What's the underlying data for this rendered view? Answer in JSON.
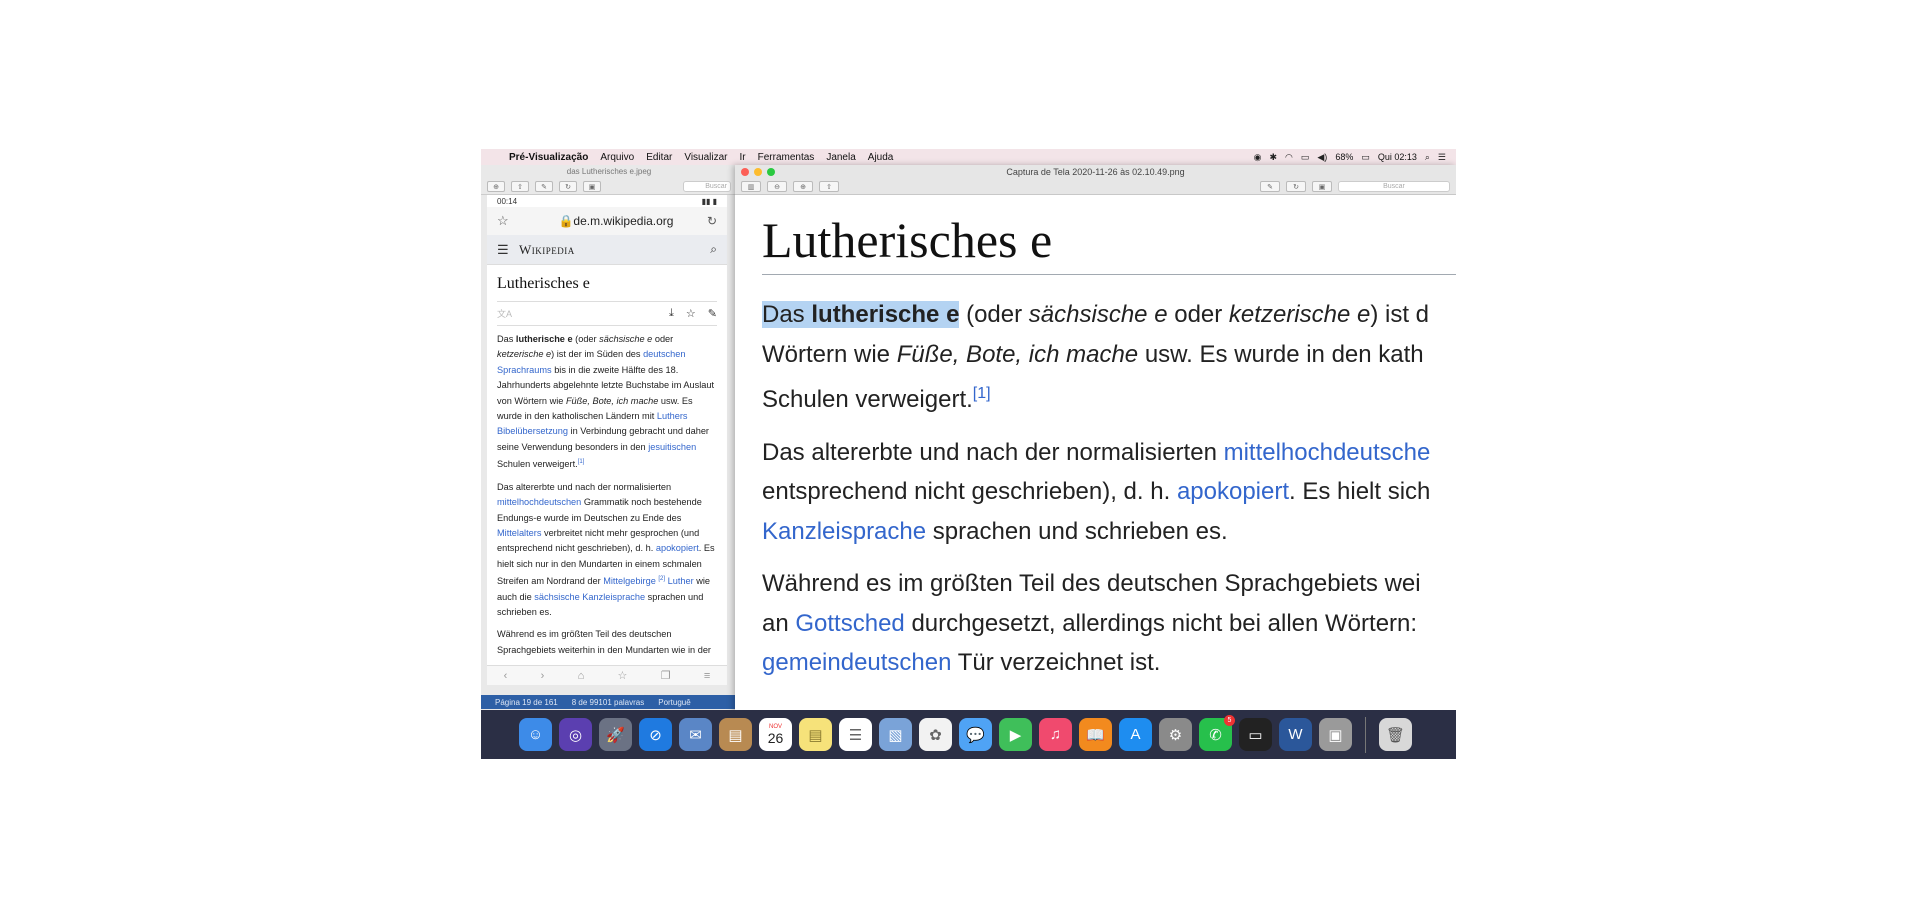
{
  "menubar": {
    "app_name": "Pré-Visualização",
    "items": [
      "Arquivo",
      "Editar",
      "Visualizar",
      "Ir",
      "Ferramentas",
      "Janela",
      "Ajuda"
    ],
    "battery": "68%",
    "clock": "Qui 02:13"
  },
  "left_window": {
    "title": "das Lutherisches e.jpeg",
    "search_placeholder": "Buscar",
    "phone": {
      "time": "00:14",
      "url": "de.m.wikipedia.org",
      "logo": "Wikipedia",
      "article_title": "Lutherisches e",
      "paragraphs": {
        "p1a": "Das ",
        "p1b": "lutherische e",
        "p1c": " (oder ",
        "p1d": "sächsische e",
        "p1e": " oder ",
        "p1f": "ketzerische e",
        "p1g": ") ist der im Süden des ",
        "p1h": "deutschen Sprachraums",
        "p1i": " bis in die zweite Hälfte des 18. Jahrhunderts abgelehnte letzte Buchstabe im Auslaut von Wörtern wie ",
        "p1j": "Füße, Bote, ich mache",
        "p1k": " usw. Es wurde in den katholischen Ländern mit ",
        "p1l": "Luthers Bibelübersetzung",
        "p1m": " in Verbindung gebracht und daher seine Verwendung besonders in den ",
        "p1n": "jesuitischen",
        "p1o": " Schulen verweigert.",
        "p1ref": "[1]",
        "p2a": "Das altererbte und nach der normalisierten ",
        "p2b": "mittelhochdeutschen",
        "p2c": " Grammatik noch bestehende Endungs-e wurde im Deutschen zu Ende des ",
        "p2d": "Mittelalters",
        "p2e": " verbreitet nicht mehr gesprochen (und entsprechend nicht geschrieben), d. h. ",
        "p2f": "apokopiert",
        "p2g": ". Es hielt sich nur in den Mundarten in einem schmalen Streifen am Nordrand der ",
        "p2h": "Mittelgebirge",
        "p2ref": "[2]",
        "p2i": " ",
        "p2j": "Luther",
        "p2k": " wie auch die ",
        "p2l": "sächsische Kanzleisprache",
        "p2m": " sprachen und schrieben es.",
        "p3": "Während es im größten Teil des deutschen Sprachgebiets weiterhin in den Mundarten wie in der"
      }
    },
    "status": {
      "page": "Página 19 de 161",
      "words": "8 de 99101 palavras",
      "language": "Portuguê"
    }
  },
  "right_window": {
    "title": "Captura de Tela 2020-11-26 às 02.10.49.png",
    "search_placeholder": "Buscar",
    "heading": "Lutherisches e",
    "l1a": "Das ",
    "l1b": "lutherische e",
    "l1c": " (oder ",
    "l1d": "sächsische e",
    "l1e": " oder ",
    "l1f": "ketzerische e",
    "l1g": ") ist d",
    "l2a": "Wörtern wie ",
    "l2b": "Füße, Bote, ich mache",
    "l2c": " usw. Es wurde in den kath",
    "l3a": "Schulen verweigert.",
    "l3ref": "[1]",
    "l4a": "Das altererbte und nach der normalisierten ",
    "l4b": "mittelhochdeutsche",
    "l5a": "entsprechend nicht geschrieben), d. h. ",
    "l5b": "apokopiert",
    "l5c": ". Es hielt sich",
    "l6a": "Kanzleisprache",
    "l6b": " sprachen und schrieben es.",
    "l7": "Während es im größten Teil des deutschen Sprachgebiets wei",
    "l8a": "an ",
    "l8b": "Gottsched",
    "l8c": " durchgesetzt, allerdings nicht bei allen Wörtern:",
    "l9a": "gemeindeutschen",
    "l9b": " Tür verzeichnet ist."
  },
  "dock": {
    "calendar_month": "NOV",
    "calendar_day": "26",
    "whatsapp_badge": "5",
    "apps": [
      {
        "name": "finder-icon",
        "color": "#3d8be8"
      },
      {
        "name": "siri-icon",
        "color": "#5b3fb0"
      },
      {
        "name": "launchpad-icon",
        "color": "#6b7284"
      },
      {
        "name": "safari-icon",
        "color": "#1f7ae0"
      },
      {
        "name": "mail-icon",
        "color": "#5a86c6"
      },
      {
        "name": "contacts-icon",
        "color": "#b88a52"
      },
      {
        "name": "calendar-icon",
        "color": "#ffffff"
      },
      {
        "name": "notes-icon",
        "color": "#f6e27a"
      },
      {
        "name": "reminders-icon",
        "color": "#ffffff"
      },
      {
        "name": "preview-icon",
        "color": "#7aa3d8"
      },
      {
        "name": "photos-icon",
        "color": "#f2f2f2"
      },
      {
        "name": "messages-icon",
        "color": "#4fa3f5"
      },
      {
        "name": "facetime-icon",
        "color": "#3fbf5a"
      },
      {
        "name": "music-icon",
        "color": "#f04a6e"
      },
      {
        "name": "books-icon",
        "color": "#f28a1e"
      },
      {
        "name": "appstore-icon",
        "color": "#1e8df0"
      },
      {
        "name": "system-preferences-icon",
        "color": "#8a8a8a"
      },
      {
        "name": "whatsapp-icon",
        "color": "#27c04c"
      },
      {
        "name": "terminal-icon",
        "color": "#222222"
      },
      {
        "name": "word-icon",
        "color": "#2b579a"
      },
      {
        "name": "image-capture-icon",
        "color": "#9a9a9a"
      }
    ]
  }
}
